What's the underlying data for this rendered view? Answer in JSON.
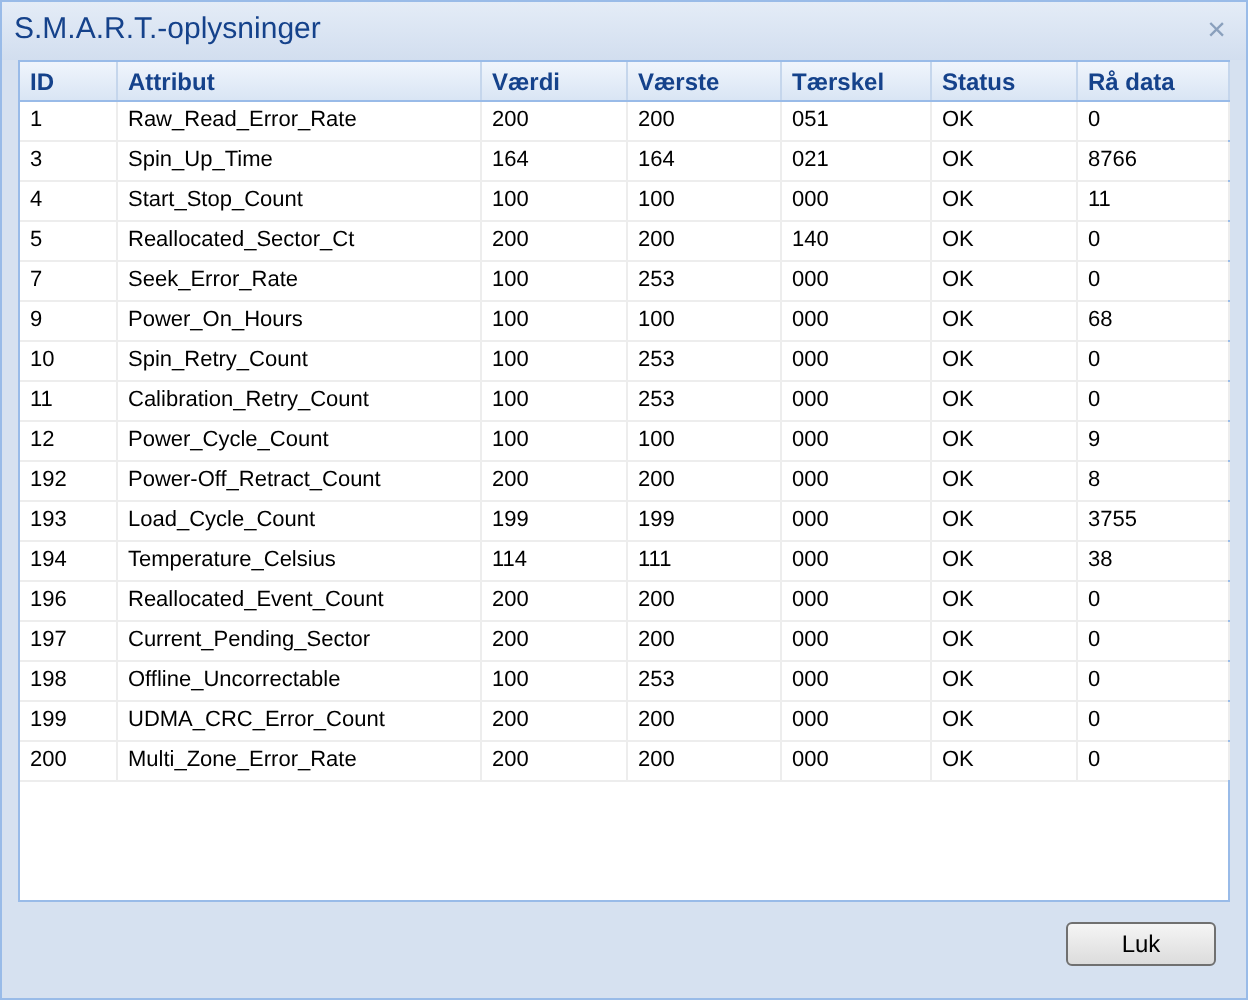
{
  "window": {
    "title": "S.M.A.R.T.-oplysninger",
    "close": "×"
  },
  "table": {
    "columns": [
      "ID",
      "Attribut",
      "Værdi",
      "Værste",
      "Tærskel",
      "Status",
      "Rå data"
    ],
    "rows": [
      [
        "1",
        "Raw_Read_Error_Rate",
        "200",
        "200",
        "051",
        "OK",
        "0"
      ],
      [
        "3",
        "Spin_Up_Time",
        "164",
        "164",
        "021",
        "OK",
        "8766"
      ],
      [
        "4",
        "Start_Stop_Count",
        "100",
        "100",
        "000",
        "OK",
        "11"
      ],
      [
        "5",
        "Reallocated_Sector_Ct",
        "200",
        "200",
        "140",
        "OK",
        "0"
      ],
      [
        "7",
        "Seek_Error_Rate",
        "100",
        "253",
        "000",
        "OK",
        "0"
      ],
      [
        "9",
        "Power_On_Hours",
        "100",
        "100",
        "000",
        "OK",
        "68"
      ],
      [
        "10",
        "Spin_Retry_Count",
        "100",
        "253",
        "000",
        "OK",
        "0"
      ],
      [
        "11",
        "Calibration_Retry_Count",
        "100",
        "253",
        "000",
        "OK",
        "0"
      ],
      [
        "12",
        "Power_Cycle_Count",
        "100",
        "100",
        "000",
        "OK",
        "9"
      ],
      [
        "192",
        "Power-Off_Retract_Count",
        "200",
        "200",
        "000",
        "OK",
        "8"
      ],
      [
        "193",
        "Load_Cycle_Count",
        "199",
        "199",
        "000",
        "OK",
        "3755"
      ],
      [
        "194",
        "Temperature_Celsius",
        "114",
        "111",
        "000",
        "OK",
        "38"
      ],
      [
        "196",
        "Reallocated_Event_Count",
        "200",
        "200",
        "000",
        "OK",
        "0"
      ],
      [
        "197",
        "Current_Pending_Sector",
        "200",
        "200",
        "000",
        "OK",
        "0"
      ],
      [
        "198",
        "Offline_Uncorrectable",
        "100",
        "253",
        "000",
        "OK",
        "0"
      ],
      [
        "199",
        "UDMA_CRC_Error_Count",
        "200",
        "200",
        "000",
        "OK",
        "0"
      ],
      [
        "200",
        "Multi_Zone_Error_Rate",
        "200",
        "200",
        "000",
        "OK",
        "0"
      ]
    ]
  },
  "buttons": [
    "Luk"
  ]
}
